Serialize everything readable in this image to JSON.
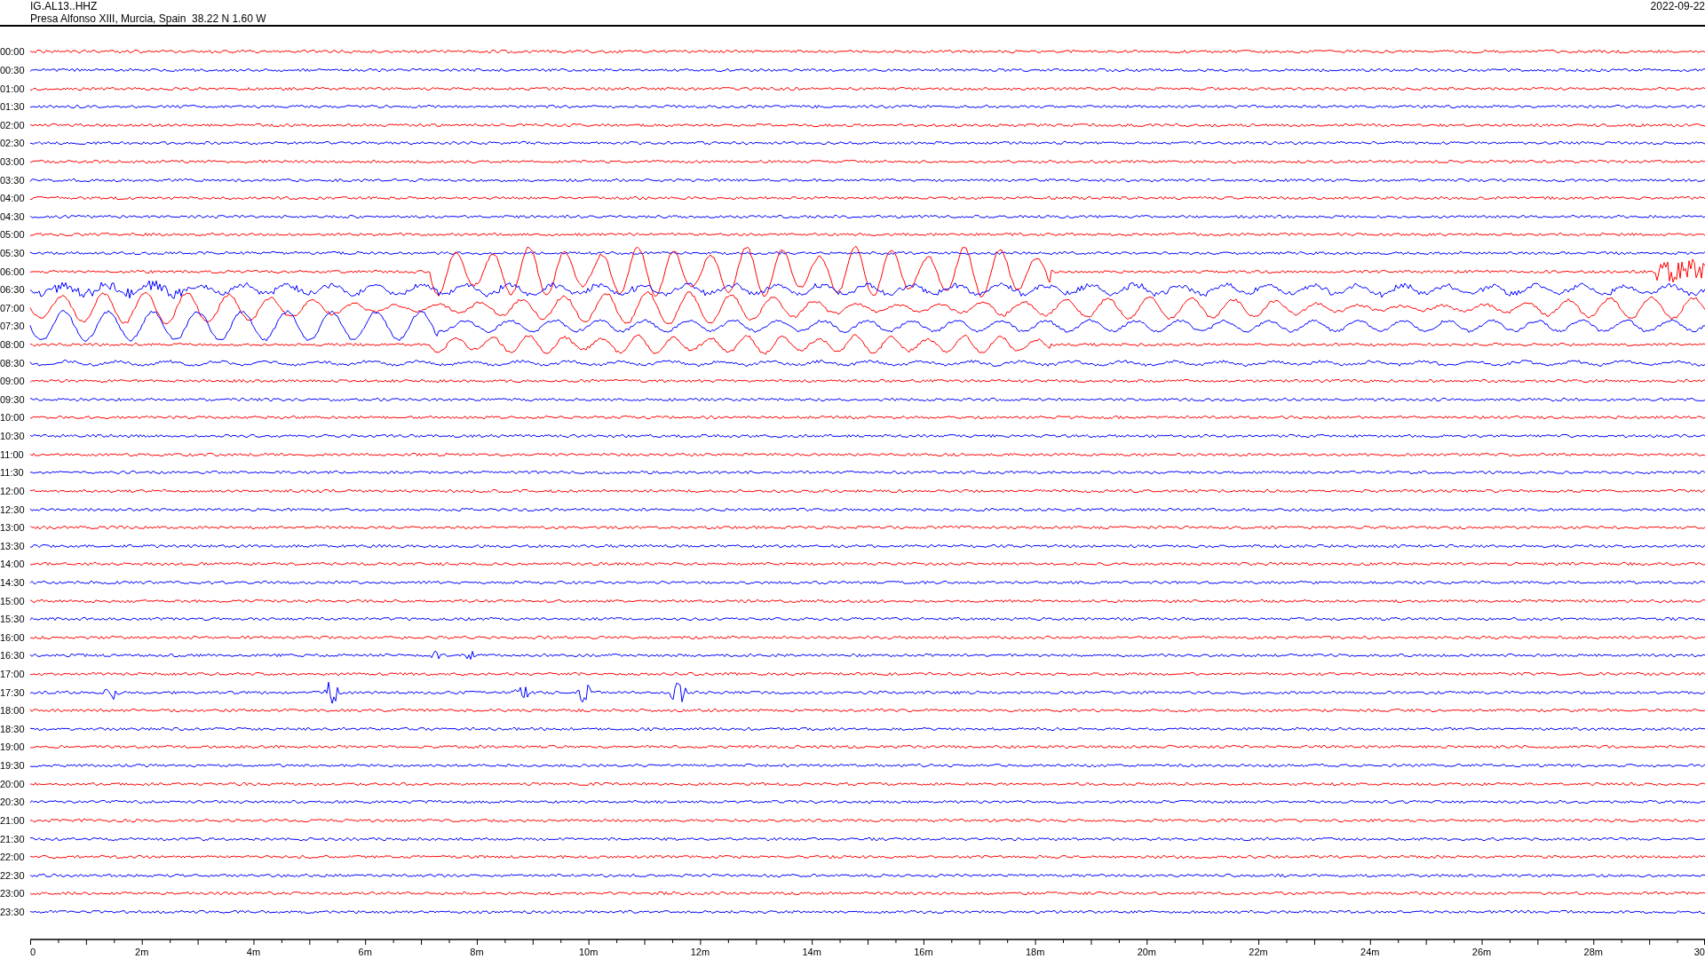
{
  "header": {
    "station": "IG.AL13..HHZ",
    "location": "Presa Alfonso XIII, Murcia, Spain  38.22 N 1.60 W",
    "date": "2022-09-22"
  },
  "traces": [
    {
      "time": "00:00",
      "color": "#ff0000"
    },
    {
      "time": "00:30",
      "color": "#0000ff"
    },
    {
      "time": "01:00",
      "color": "#ff0000"
    },
    {
      "time": "01:30",
      "color": "#0000ff"
    },
    {
      "time": "02:00",
      "color": "#ff0000"
    },
    {
      "time": "02:30",
      "color": "#0000ff"
    },
    {
      "time": "03:00",
      "color": "#ff0000"
    },
    {
      "time": "03:30",
      "color": "#0000ff"
    },
    {
      "time": "04:00",
      "color": "#ff0000"
    },
    {
      "time": "04:30",
      "color": "#0000ff"
    },
    {
      "time": "05:00",
      "color": "#ff0000"
    },
    {
      "time": "05:30",
      "color": "#0000ff"
    },
    {
      "time": "06:00",
      "color": "#ff0000"
    },
    {
      "time": "06:30",
      "color": "#0000ff"
    },
    {
      "time": "07:00",
      "color": "#ff0000"
    },
    {
      "time": "07:30",
      "color": "#0000ff"
    },
    {
      "time": "08:00",
      "color": "#ff0000"
    },
    {
      "time": "08:30",
      "color": "#0000ff"
    },
    {
      "time": "09:00",
      "color": "#ff0000"
    },
    {
      "time": "09:30",
      "color": "#0000ff"
    },
    {
      "time": "10:00",
      "color": "#ff0000"
    },
    {
      "time": "10:30",
      "color": "#0000ff"
    },
    {
      "time": "11:00",
      "color": "#ff0000"
    },
    {
      "time": "11:30",
      "color": "#0000ff"
    },
    {
      "time": "12:00",
      "color": "#ff0000"
    },
    {
      "time": "12:30",
      "color": "#0000ff"
    },
    {
      "time": "13:00",
      "color": "#ff0000"
    },
    {
      "time": "13:30",
      "color": "#0000ff"
    },
    {
      "time": "14:00",
      "color": "#ff0000"
    },
    {
      "time": "14:30",
      "color": "#0000ff"
    },
    {
      "time": "15:00",
      "color": "#ff0000"
    },
    {
      "time": "15:30",
      "color": "#0000ff"
    },
    {
      "time": "16:00",
      "color": "#ff0000"
    },
    {
      "time": "16:30",
      "color": "#0000ff"
    },
    {
      "time": "17:00",
      "color": "#ff0000"
    },
    {
      "time": "17:30",
      "color": "#0000ff"
    },
    {
      "time": "18:00",
      "color": "#ff0000"
    },
    {
      "time": "18:30",
      "color": "#0000ff"
    },
    {
      "time": "19:00",
      "color": "#ff0000"
    },
    {
      "time": "19:30",
      "color": "#0000ff"
    },
    {
      "time": "20:00",
      "color": "#ff0000"
    },
    {
      "time": "20:30",
      "color": "#0000ff"
    },
    {
      "time": "21:00",
      "color": "#ff0000"
    },
    {
      "time": "21:30",
      "color": "#0000ff"
    },
    {
      "time": "22:00",
      "color": "#ff0000"
    },
    {
      "time": "22:30",
      "color": "#0000ff"
    },
    {
      "time": "23:00",
      "color": "#ff0000"
    },
    {
      "time": "23:30",
      "color": "#0000ff"
    }
  ],
  "x_axis": {
    "ticks": [
      "0",
      "2m",
      "4m",
      "6m",
      "8m",
      "10m",
      "12m",
      "14m",
      "16m",
      "18m",
      "20m",
      "22m",
      "24m",
      "26m",
      "28m",
      "30"
    ]
  }
}
